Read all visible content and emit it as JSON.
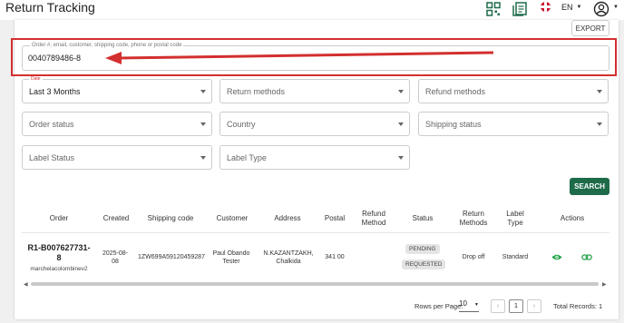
{
  "header": {
    "title": "Return Tracking",
    "language": "EN"
  },
  "toolbar": {
    "export_label": "EXPORT"
  },
  "search": {
    "label": "Order #, email, customer, shipping code, phone or postal code",
    "value": "0040789486-8"
  },
  "filters": {
    "date_label": "Date",
    "date_value": "Last 3 Months",
    "return_methods": "Return methods",
    "refund_methods": "Refund methods",
    "order_status": "Order status",
    "country": "Country",
    "shipping_status": "Shipping status",
    "label_status": "Label Status",
    "label_type": "Label Type",
    "search_label": "SEARCH"
  },
  "table": {
    "headers": {
      "order": "Order",
      "created": "Created",
      "shipping_code": "Shipping code",
      "customer": "Customer",
      "address": "Address",
      "postal": "Postal",
      "refund_method": "Refund Method",
      "status": "Status",
      "return_methods": "Return Methods",
      "label_type": "Label Type",
      "actions": "Actions"
    },
    "row": {
      "order_id": "R1-B007627731-8",
      "order_user": "marchelacolombinev2",
      "created": "2025-08-08",
      "shipping_code": "1ZW699A59120459287",
      "customer": "Paul Obando Tester",
      "address": "N.KAZANTZAKH, Chalkida",
      "postal": "341 00",
      "refund_method": "",
      "status_1": "PENDING",
      "status_2": "REQUESTED",
      "return_method": "Drop off",
      "label_type": "Standard"
    }
  },
  "pagination": {
    "rows_label": "Rows per Page:",
    "rows_value": "10",
    "page": "1",
    "total": "Total Records: 1"
  },
  "colors": {
    "primary": "#1e6b4a",
    "highlight": "#d32f2f",
    "action": "#22a34a"
  }
}
